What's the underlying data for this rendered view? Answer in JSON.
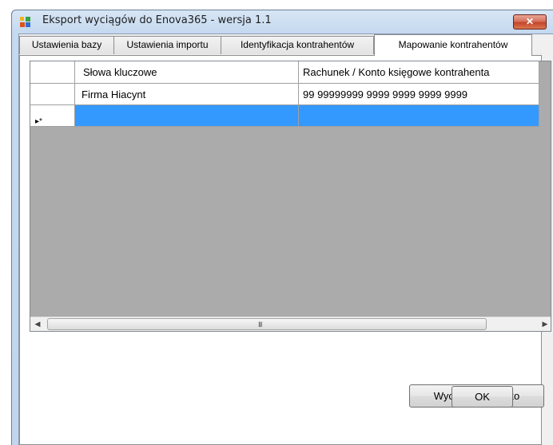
{
  "window": {
    "title": "Eksport wyciągów do Enova365 - wersja 1.1",
    "close_glyph": "✕",
    "icon": "app-icon"
  },
  "tabs": [
    {
      "label": "Ustawienia bazy"
    },
    {
      "label": "Ustawienia importu"
    },
    {
      "label": "Identyfikacja kontrahentów"
    },
    {
      "label": "Mapowanie kontrahentów",
      "active": true
    }
  ],
  "grid": {
    "columns": [
      "Słowa kluczowe",
      "Rachunek / Konto księgowe kontrahenta"
    ],
    "rows": [
      [
        "Firma Hiacynt",
        "99 99999999 9999 9999 9999 9999"
      ]
    ],
    "new_row_marker": "▸*",
    "scroll_grip": "III",
    "scroll_left": "◀",
    "scroll_right": "▶"
  },
  "buttons": {
    "clear_all": "Wyczyść wszystko",
    "ok": "OK"
  },
  "colors": {
    "selection": "#3399ff",
    "grid_background": "#ababab"
  }
}
